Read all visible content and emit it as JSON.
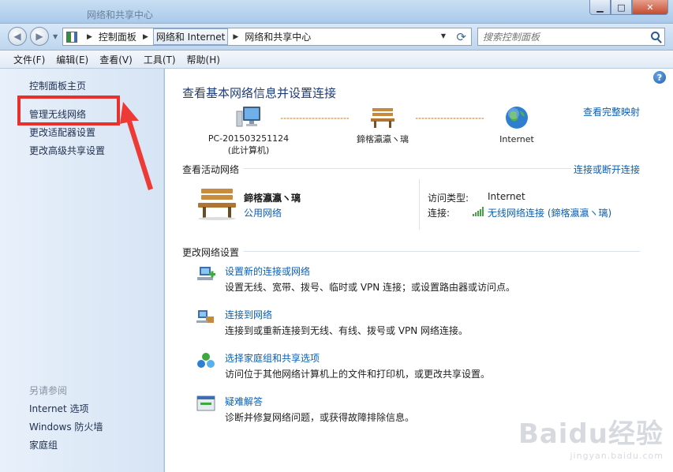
{
  "window": {
    "title": "网络和共享中心"
  },
  "nav": {
    "breadcrumbs": [
      "控制面板",
      "网络和 Internet",
      "网络和共享中心"
    ],
    "search_placeholder": "搜索控制面板"
  },
  "menu": [
    "文件(F)",
    "编辑(E)",
    "查看(V)",
    "工具(T)",
    "帮助(H)"
  ],
  "sidebar": {
    "links": [
      "控制面板主页",
      "管理无线网络",
      "更改适配器设置",
      "更改高级共享设置"
    ],
    "see_also_label": "另请参阅",
    "see_also": [
      "Internet 选项",
      "Windows 防火墙",
      "家庭组"
    ]
  },
  "main": {
    "title": "查看基本网络信息并设置连接",
    "full_map_link": "查看完整映射",
    "map": {
      "computer_name": "PC-201503251124",
      "computer_sub": "(此计算机)",
      "network_name": "鍗楁瀛瀛ヽ璃",
      "internet": "Internet"
    },
    "active_label": "查看活动网络",
    "connect_link": "连接或断开连接",
    "active_network": {
      "name": "鍗楁瀛瀛ヽ璃",
      "type": "公用网络",
      "access_label": "访问类型:",
      "access_value": "Internet",
      "conn_label": "连接:",
      "conn_value": "无线网络连接 (鍗楁瀛瀛ヽ璃)"
    },
    "change_label": "更改网络设置",
    "tasks": [
      {
        "title": "设置新的连接或网络",
        "desc": "设置无线、宽带、拨号、临时或 VPN 连接；或设置路由器或访问点。"
      },
      {
        "title": "连接到网络",
        "desc": "连接到或重新连接到无线、有线、拨号或 VPN 网络连接。"
      },
      {
        "title": "选择家庭组和共享选项",
        "desc": "访问位于其他网络计算机上的文件和打印机，或更改共享设置。"
      },
      {
        "title": "疑难解答",
        "desc": "诊断并修复网络问题，或获得故障排除信息。"
      }
    ]
  },
  "watermark": {
    "logo": "Baidu经验",
    "url": "jingyan.baidu.com"
  }
}
